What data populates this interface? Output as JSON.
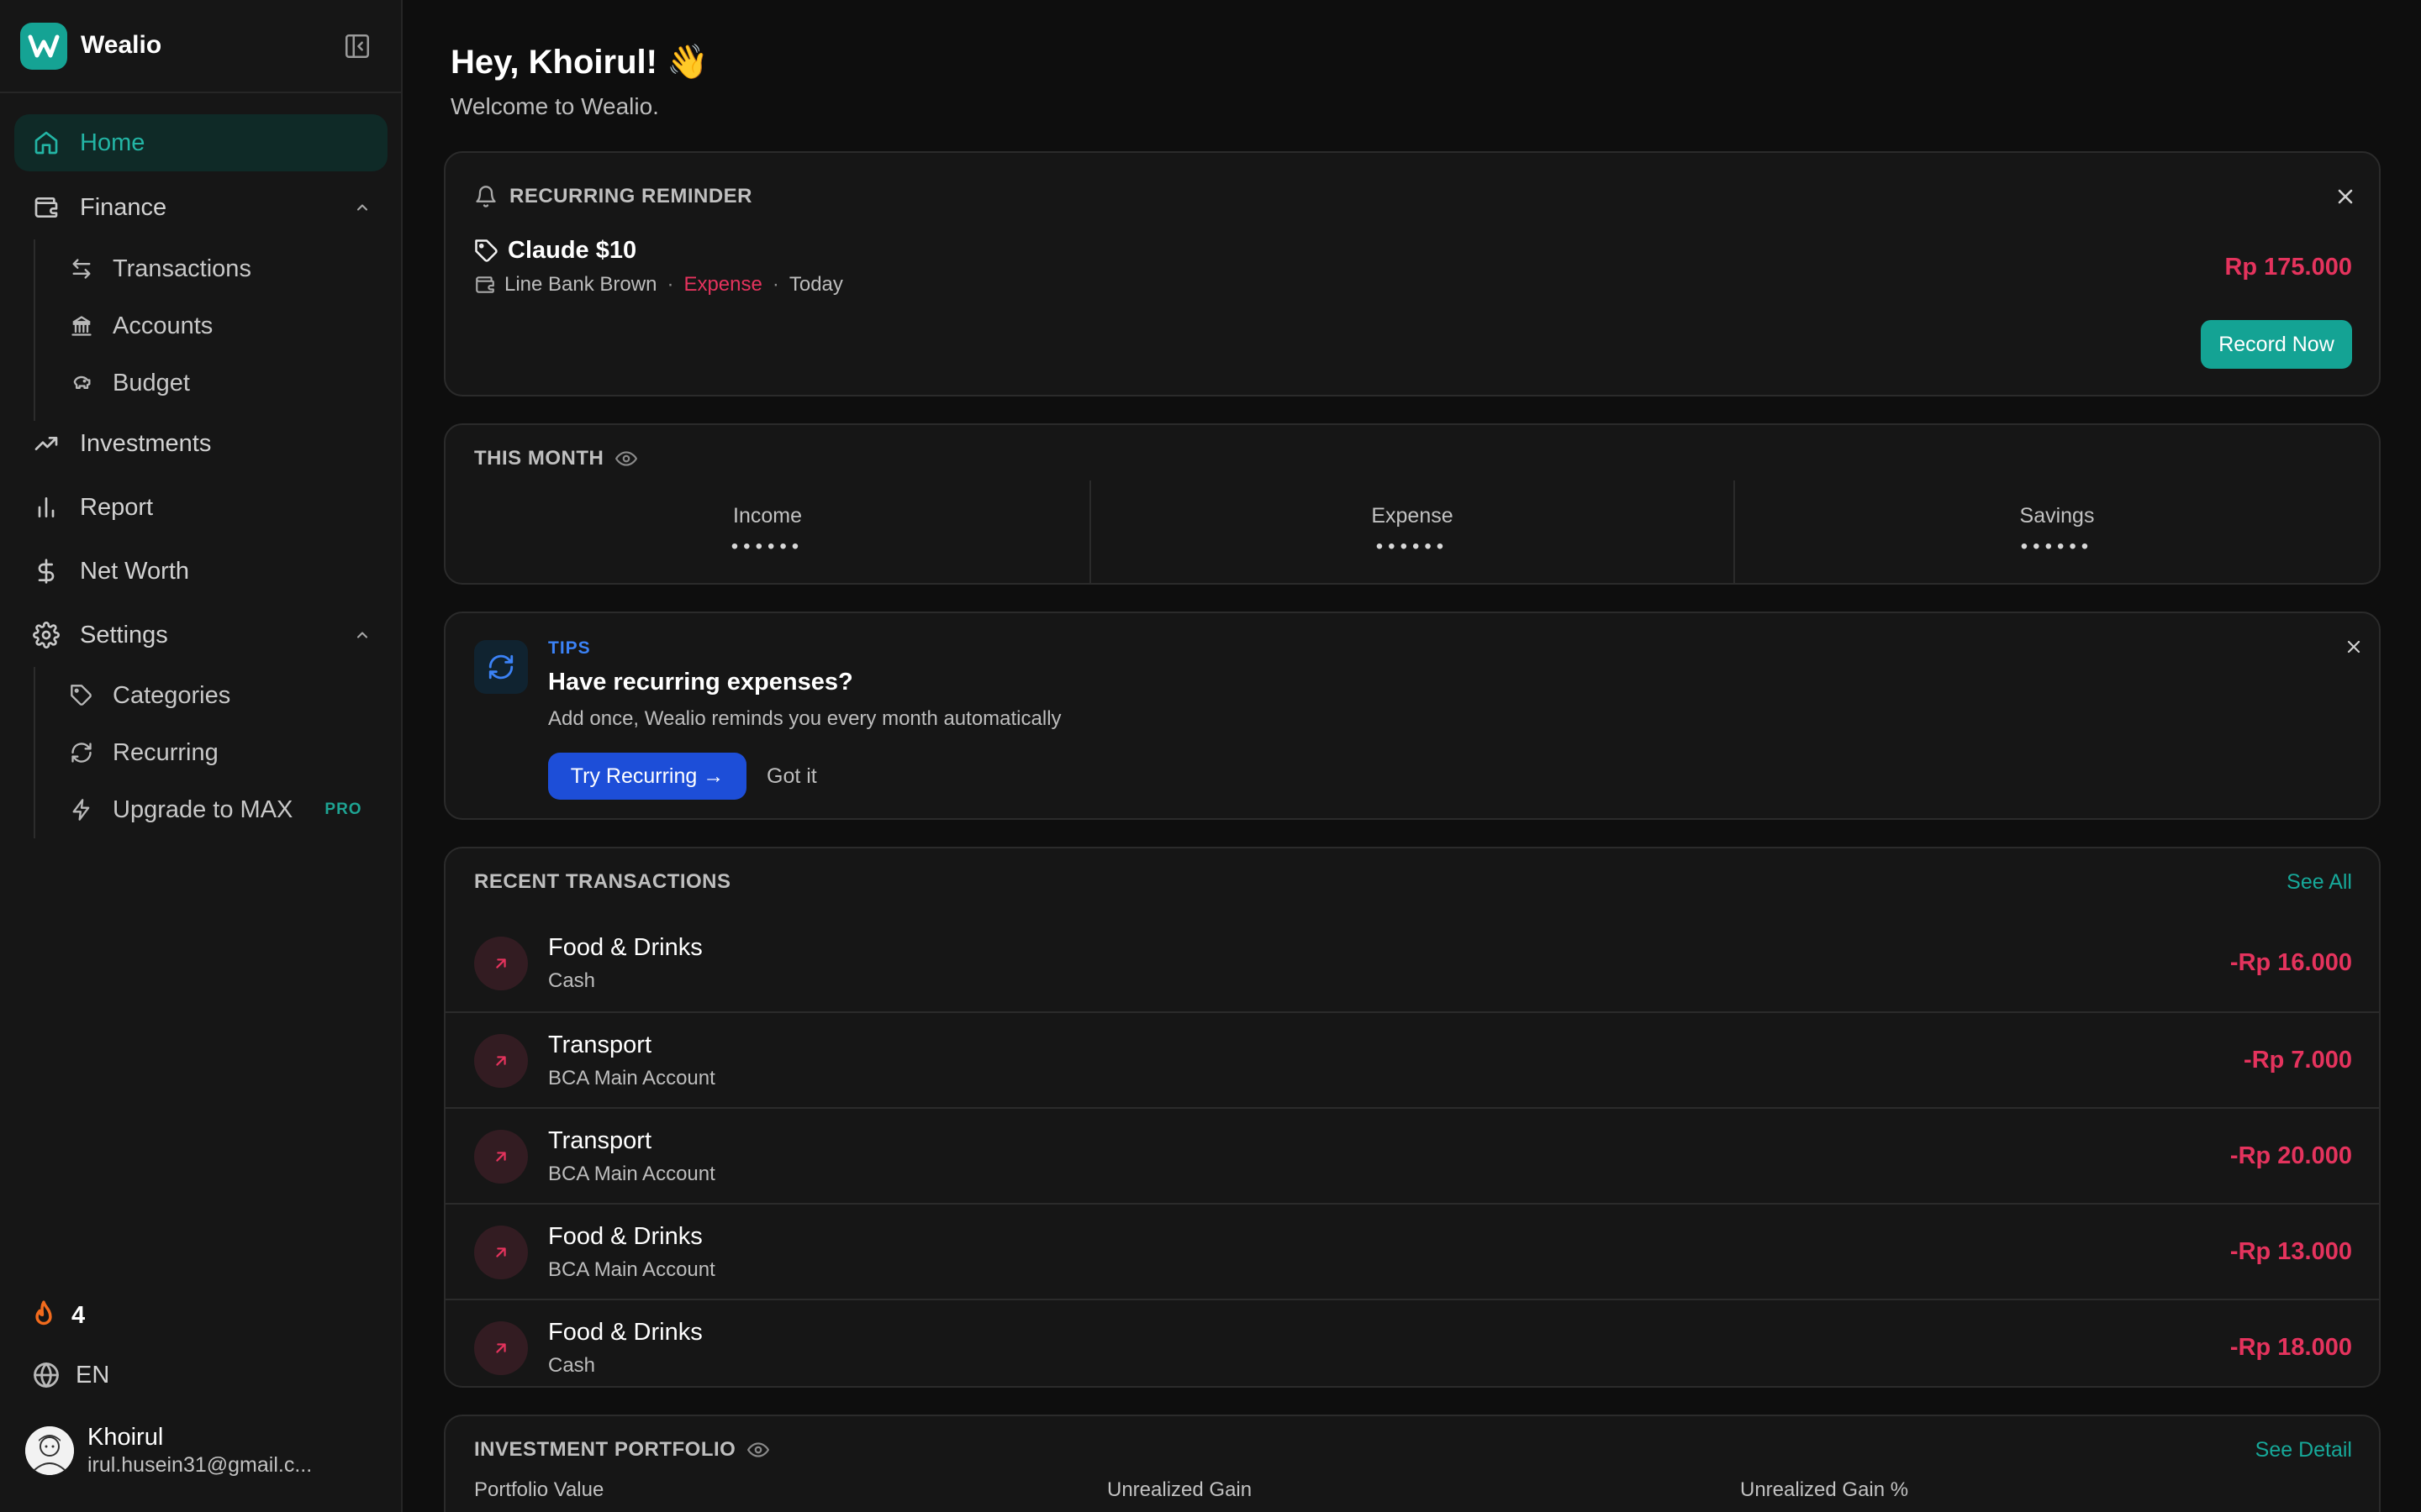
{
  "app": {
    "name": "Wealio"
  },
  "sidebar": {
    "home": "Home",
    "finance": {
      "label": "Finance",
      "items": [
        "Transactions",
        "Accounts",
        "Budget"
      ]
    },
    "investments": "Investments",
    "report": "Report",
    "net_worth": "Net Worth",
    "settings": {
      "label": "Settings",
      "items": [
        "Categories",
        "Recurring",
        "Upgrade to MAX"
      ],
      "pro_badge": "PRO"
    },
    "streak": "4",
    "language": "EN",
    "user": {
      "name": "Khoirul",
      "email": "irul.husein31@gmail.c..."
    }
  },
  "header": {
    "greeting": "Hey, Khoirul! 👋",
    "subtitle": "Welcome to Wealio."
  },
  "reminder": {
    "title": "RECURRING REMINDER",
    "item_name": "Claude $10",
    "account": "Line Bank Brown",
    "type": "Expense",
    "when": "Today",
    "amount": "Rp 175.000",
    "button": "Record Now"
  },
  "this_month": {
    "title": "THIS MONTH",
    "columns": [
      {
        "label": "Income",
        "value": "••••••"
      },
      {
        "label": "Expense",
        "value": "••••••"
      },
      {
        "label": "Savings",
        "value": "••••••"
      }
    ]
  },
  "tips": {
    "tag": "TIPS",
    "title": "Have recurring expenses?",
    "text": "Add once, Wealio reminds you every month automatically",
    "primary": "Try Recurring →",
    "secondary": "Got it"
  },
  "recent": {
    "title": "RECENT TRANSACTIONS",
    "see_all": "See All",
    "rows": [
      {
        "title": "Food & Drinks",
        "account": "Cash",
        "amount": "-Rp 16.000"
      },
      {
        "title": "Transport",
        "account": "BCA Main Account",
        "amount": "-Rp 7.000"
      },
      {
        "title": "Transport",
        "account": "BCA Main Account",
        "amount": "-Rp 20.000"
      },
      {
        "title": "Food & Drinks",
        "account": "BCA Main Account",
        "amount": "-Rp 13.000"
      },
      {
        "title": "Food & Drinks",
        "account": "Cash",
        "amount": "-Rp 18.000"
      }
    ]
  },
  "investment": {
    "title": "INVESTMENT PORTFOLIO",
    "see_detail": "See Detail",
    "columns": [
      "Portfolio Value",
      "Unrealized Gain",
      "Unrealized Gain %"
    ]
  },
  "colors": {
    "accent": "#14a394",
    "expense": "#e4335d",
    "tips_blue": "#1d4ed8",
    "background": "#0e0e0e",
    "card": "#161616"
  },
  "icons": {
    "brand": "wealio-logo-icon",
    "collapse": "sidebar-collapse-icon",
    "home": "home-icon",
    "finance": "wallet-icon",
    "transactions": "arrows-swap-icon",
    "accounts": "bank-icon",
    "budget": "piggy-bank-icon",
    "investments": "trending-up-icon",
    "report": "bar-chart-icon",
    "net_worth": "dollar-icon",
    "settings": "gear-icon",
    "categories": "tag-icon",
    "recurring": "refresh-icon",
    "upgrade": "lightning-icon",
    "streak": "flame-icon",
    "language": "globe-icon",
    "bell": "bell-icon",
    "close": "close-icon",
    "eye": "eye-icon",
    "expense_arrow": "arrow-up-right-icon"
  }
}
